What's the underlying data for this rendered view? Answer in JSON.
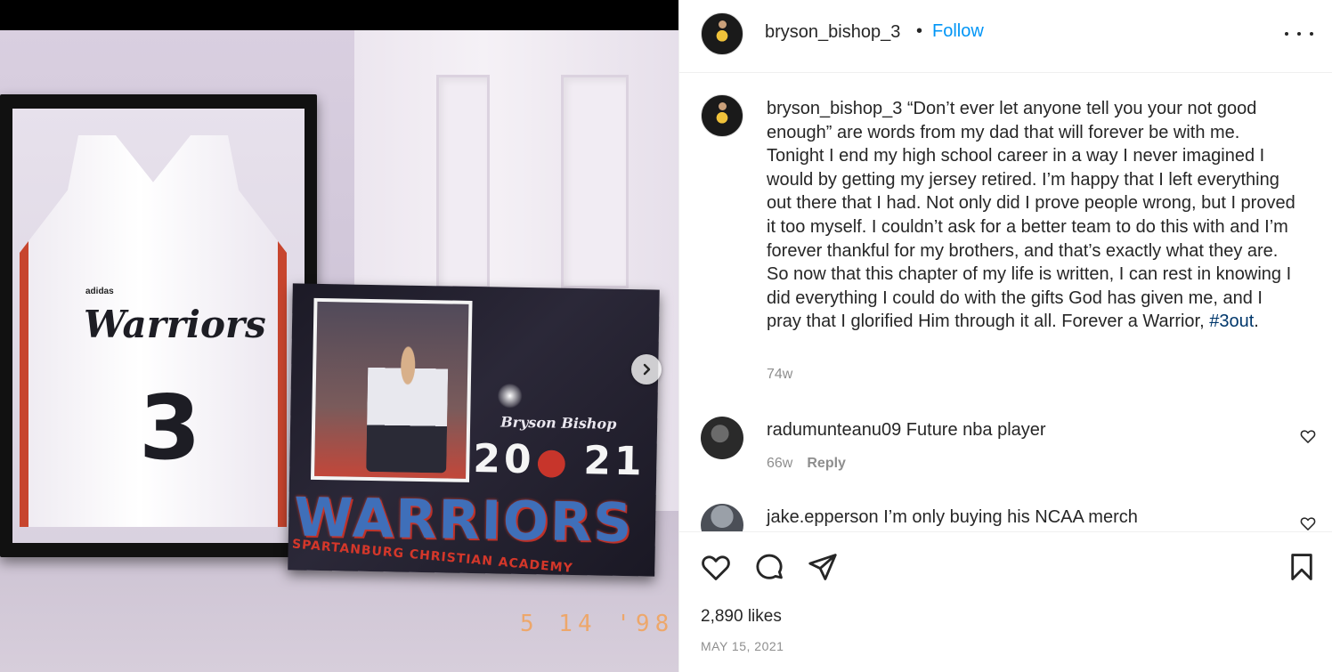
{
  "media": {
    "jersey_team": "Warriors",
    "jersey_number": "3",
    "jersey_brand": "adidas",
    "poster_name": "Bryson Bishop",
    "poster_year_left": "20",
    "poster_year_right": "21",
    "poster_team": "WARRIORS",
    "poster_school": "SPARTANBURG CHRISTIAN ACADEMY",
    "photo_date_stamp": "5 14 '98",
    "next_icon": "chevron-right-icon"
  },
  "header": {
    "username": "bryson_bishop_3",
    "separator": "•",
    "follow_label": "Follow",
    "more_icon": "more-horizontal-icon"
  },
  "caption": {
    "username": "bryson_bishop_3",
    "text": " “Don’t ever let anyone tell you your not good enough” are words from my dad that will forever be with me. Tonight I end my high school career in a way I never imagined I would by getting my jersey retired. I’m happy that I left everything out there that I had. Not only did I prove people wrong, but I proved it too myself. I couldn’t ask for a better team to do this with and I’m forever thankful for my brothers, and that’s exactly what they are. So now that this chapter of my life is written, I can rest in knowing I did everything I could do with the gifts God has given me, and I pray that I glorified Him through it all. Forever a Warrior, ",
    "hashtag": "#3out",
    "end": ".",
    "age": "74w"
  },
  "comments": [
    {
      "username": "radumunteanu09",
      "text": " Future nba player",
      "age": "66w",
      "reply_label": "Reply"
    },
    {
      "username": "jake.epperson",
      "text": " I’m only buying his NCAA merch"
    }
  ],
  "actions": {
    "like_icon": "heart-icon",
    "comment_icon": "comment-icon",
    "share_icon": "send-icon",
    "save_icon": "bookmark-icon"
  },
  "likes": "2,890 likes",
  "date": "MAY 15, 2021",
  "colors": {
    "link": "#0095f6",
    "hashtag": "#00376b",
    "muted": "#8e8e8e",
    "text": "#262626"
  }
}
